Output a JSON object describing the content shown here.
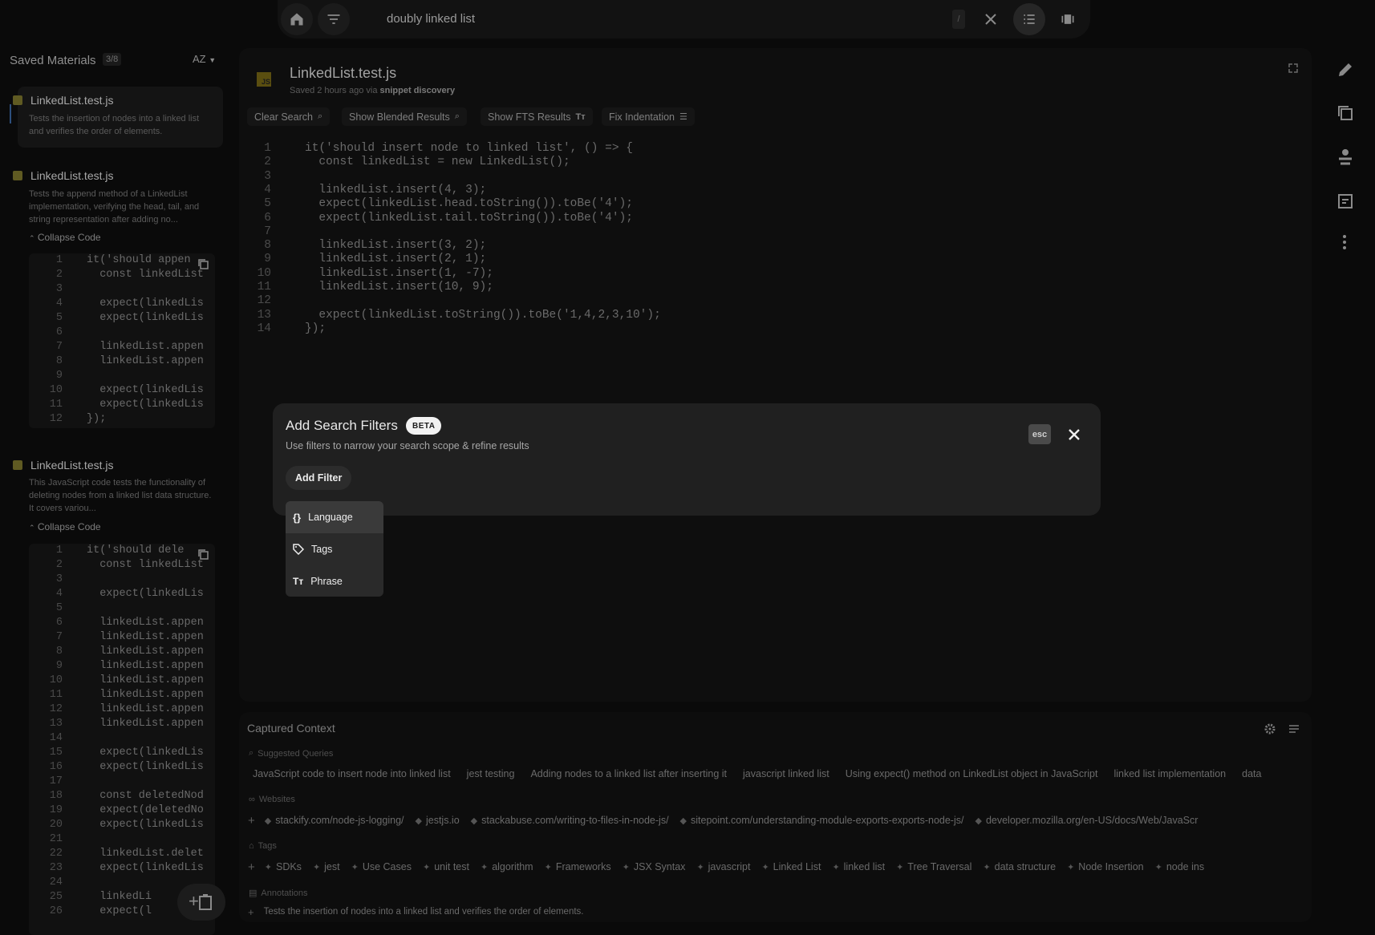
{
  "topbar": {
    "search_value": "doubly linked list",
    "slash_hint": "/"
  },
  "sidebar": {
    "title": "Saved Materials",
    "count": "3/8",
    "sort_label": "AZ",
    "cards": [
      {
        "title": "LinkedList.test.js",
        "description": "Tests the insertion of nodes into a linked list and verifies the order of elements."
      },
      {
        "title": "LinkedList.test.js",
        "description": "Tests the append method of a LinkedList implementation, verifying the head, tail, and string representation after adding no...",
        "collapse_label": "Collapse Code",
        "code": [
          "it('should appen",
          "  const linkedList",
          "",
          "  expect(linkedLis",
          "  expect(linkedLis",
          "",
          "  linkedList.appen",
          "  linkedList.appen",
          "",
          "  expect(linkedLis",
          "  expect(linkedLis",
          "});"
        ]
      },
      {
        "title": "LinkedList.test.js",
        "description": "This JavaScript code tests the functionality of deleting nodes from a linked list data structure. It covers variou...",
        "collapse_label": "Collapse Code",
        "code": [
          "it('should dele",
          "  const linkedList",
          "",
          "  expect(linkedLis",
          "",
          "  linkedList.appen",
          "  linkedList.appen",
          "  linkedList.appen",
          "  linkedList.appen",
          "  linkedList.appen",
          "  linkedList.appen",
          "  linkedList.appen",
          "  linkedList.appen",
          "",
          "  expect(linkedLis",
          "  expect(linkedLis",
          "",
          "  const deletedNod",
          "  expect(deletedNo",
          "  expect(linkedLis",
          "",
          "  linkedList.delet",
          "  expect(linkedLis",
          "",
          "  linkedLi",
          "  expect(l"
        ]
      }
    ]
  },
  "main": {
    "file_badge": "JS",
    "file_title": "LinkedList.test.js",
    "saved_text": "Saved 2 hours ago via ",
    "saved_source": "snippet discovery",
    "actions": [
      "Clear Search",
      "Show Blended Results",
      "Show FTS Results",
      "Fix Indentation"
    ],
    "code_lines": [
      "it('should insert node to linked list', () => {",
      "  const linkedList = new LinkedList();",
      "",
      "  linkedList.insert(4, 3);",
      "  expect(linkedList.head.toString()).toBe('4');",
      "  expect(linkedList.tail.toString()).toBe('4');",
      "",
      "  linkedList.insert(3, 2);",
      "  linkedList.insert(2, 1);",
      "  linkedList.insert(1, -7);",
      "  linkedList.insert(10, 9);",
      "",
      "  expect(linkedList.toString()).toBe('1,4,2,3,10');",
      "});"
    ]
  },
  "dialog": {
    "title": "Add Search Filters",
    "beta": "BETA",
    "subtitle": "Use filters to narrow your search scope & refine results",
    "add_filter": "Add Filter",
    "esc": "esc",
    "menu": [
      "Language",
      "Tags",
      "Phrase"
    ]
  },
  "context": {
    "title": "Captured Context",
    "suggested_label": "Suggested Queries",
    "queries": [
      "JavaScript code to insert node into linked list",
      "jest testing",
      "Adding nodes to a linked list after inserting it",
      "javascript linked list",
      "Using expect() method on LinkedList object in JavaScript",
      "linked list implementation",
      "data"
    ],
    "websites_label": "Websites",
    "websites": [
      "stackify.com/node-js-logging/",
      "jestjs.io",
      "stackabuse.com/writing-to-files-in-node-js/",
      "sitepoint.com/understanding-module-exports-exports-node-js/",
      "developer.mozilla.org/en-US/docs/Web/JavaScr"
    ],
    "tags_label": "Tags",
    "tags": [
      "SDKs",
      "jest",
      "Use Cases",
      "unit test",
      "algorithm",
      "Frameworks",
      "JSX Syntax",
      "javascript",
      "Linked List",
      "linked list",
      "Tree Traversal",
      "data structure",
      "Node Insertion",
      "node ins"
    ],
    "annotations_label": "Annotations",
    "annotation": "Tests the insertion of nodes into a linked list and verifies the order of elements."
  }
}
